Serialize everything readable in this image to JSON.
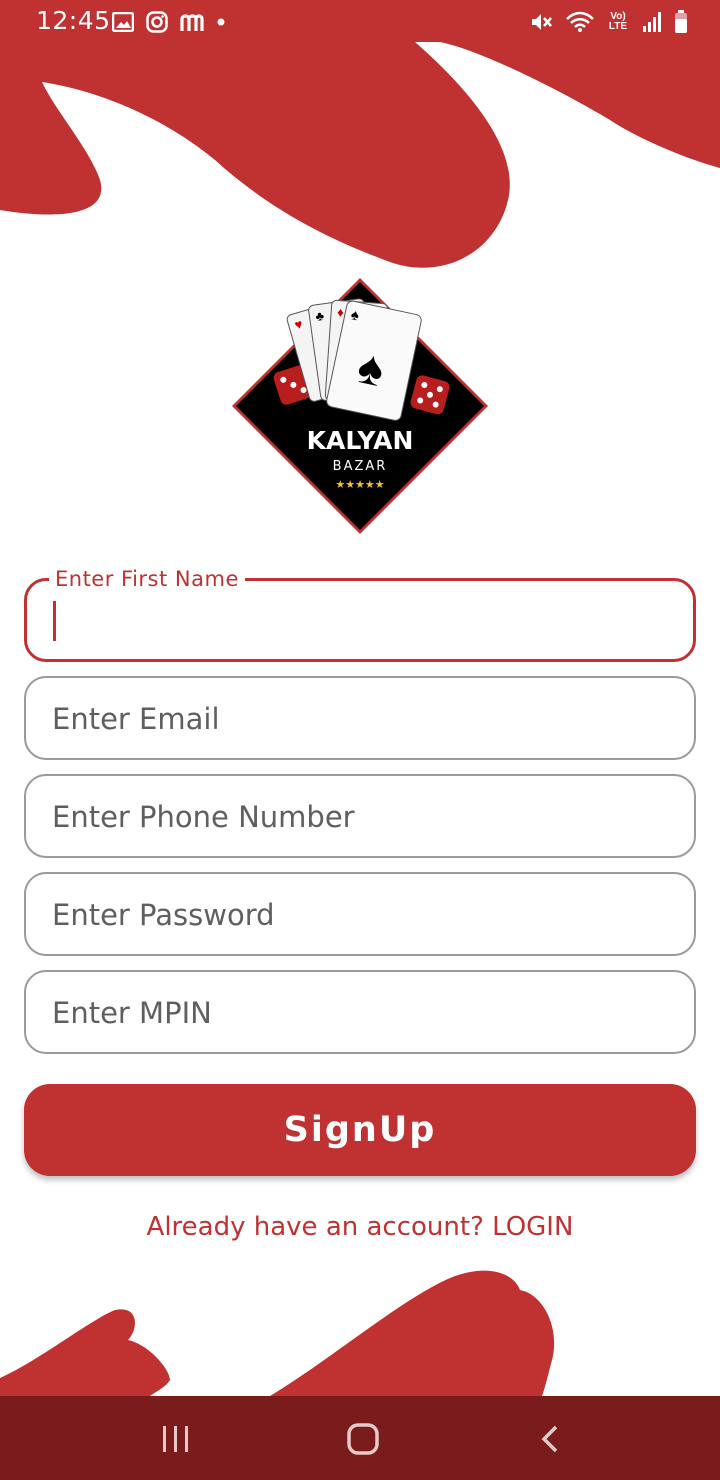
{
  "status_bar": {
    "time": "12:45",
    "left_icons": [
      "image-icon",
      "instagram-icon",
      "m-app-icon",
      "dot-icon"
    ],
    "right_icons": [
      "mute-icon",
      "wifi-icon",
      "volte-icon",
      "signal-icon",
      "battery-icon"
    ],
    "volte_text": "Vo) LTE"
  },
  "logo": {
    "title": "KALYAN",
    "subtitle": "BAZAR",
    "stars": "★★★★★"
  },
  "form": {
    "first_name_label": "Enter First Name",
    "first_name_value": "",
    "email_placeholder": "Enter Email",
    "phone_placeholder": "Enter Phone Number",
    "password_placeholder": "Enter Password",
    "mpin_placeholder": "Enter MPIN"
  },
  "signup_label": "SignUp",
  "login_link": "Already have an account? LOGIN",
  "colors": {
    "accent": "#c03232",
    "nav_bar": "#7a1c1c",
    "border": "#9a9a9a"
  }
}
